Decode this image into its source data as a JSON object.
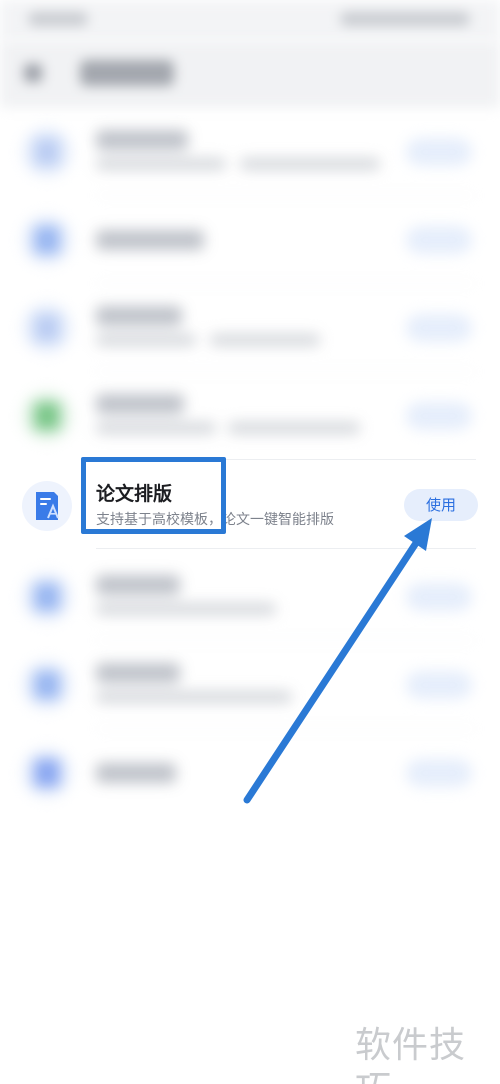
{
  "item": {
    "title": "论文排版",
    "description": "支持基于高校模板，论文一键智能排版",
    "action_label": "使用",
    "icon": "document-format-icon"
  },
  "watermark": "软件技巧",
  "colors": {
    "accent": "#2b6fe0",
    "annotation": "#2a79d5",
    "button_bg": "#e6eefc"
  }
}
